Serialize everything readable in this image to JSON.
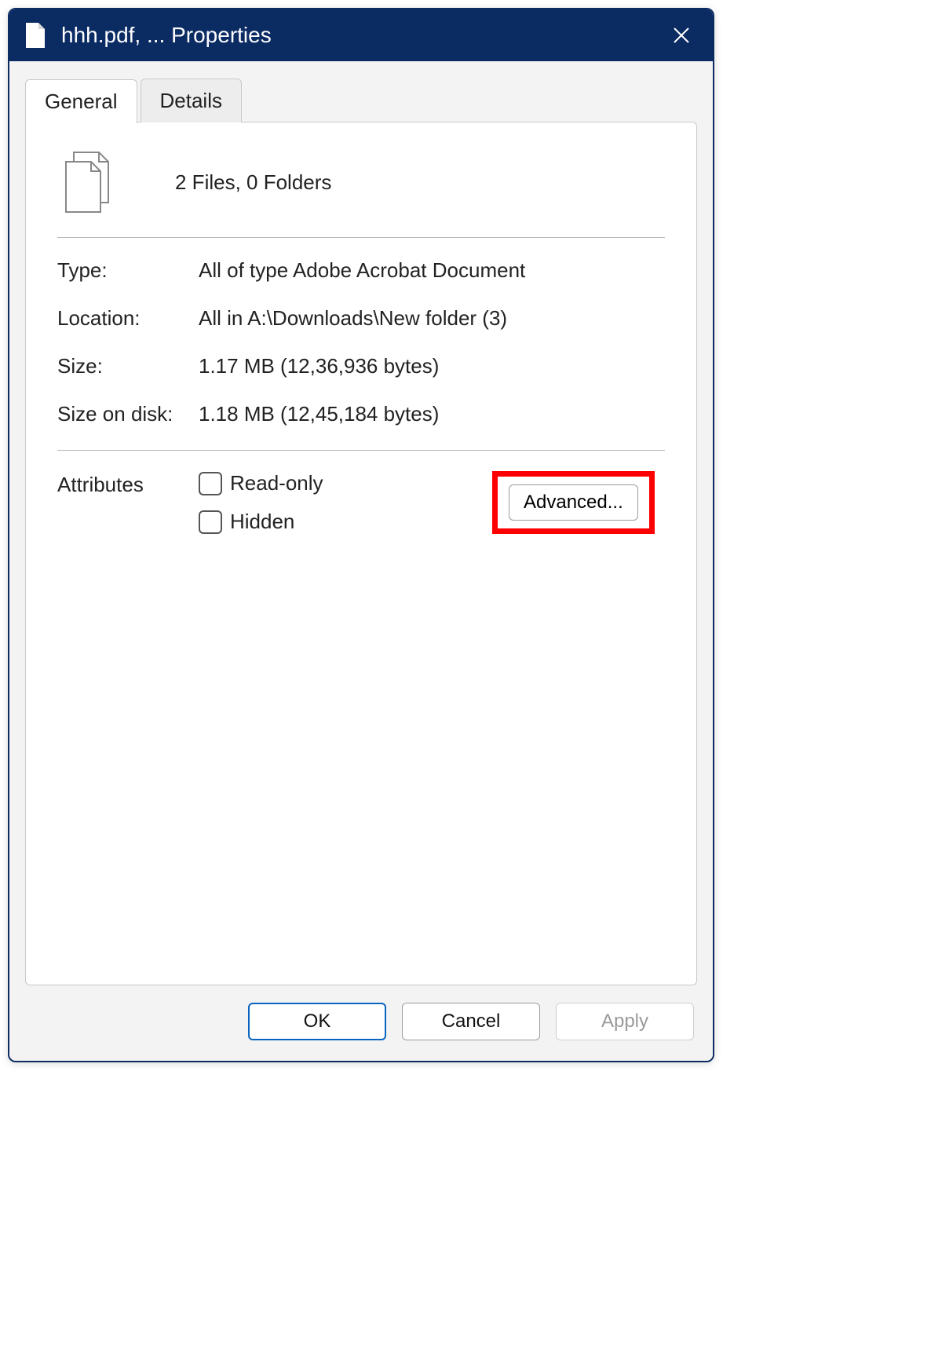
{
  "titlebar": {
    "title": "hhh.pdf, ... Properties"
  },
  "tabs": {
    "general": "General",
    "details": "Details"
  },
  "summary": {
    "text": "2 Files, 0 Folders"
  },
  "properties": {
    "type_label": "Type:",
    "type_value": "All of type Adobe Acrobat Document",
    "location_label": "Location:",
    "location_value": "All in A:\\Downloads\\New folder (3)",
    "size_label": "Size:",
    "size_value": "1.17 MB (12,36,936 bytes)",
    "size_on_disk_label": "Size on disk:",
    "size_on_disk_value": "1.18 MB (12,45,184 bytes)"
  },
  "attributes": {
    "label": "Attributes",
    "readonly_label": "Read-only",
    "hidden_label": "Hidden",
    "advanced_label": "Advanced..."
  },
  "buttons": {
    "ok": "OK",
    "cancel": "Cancel",
    "apply": "Apply"
  }
}
